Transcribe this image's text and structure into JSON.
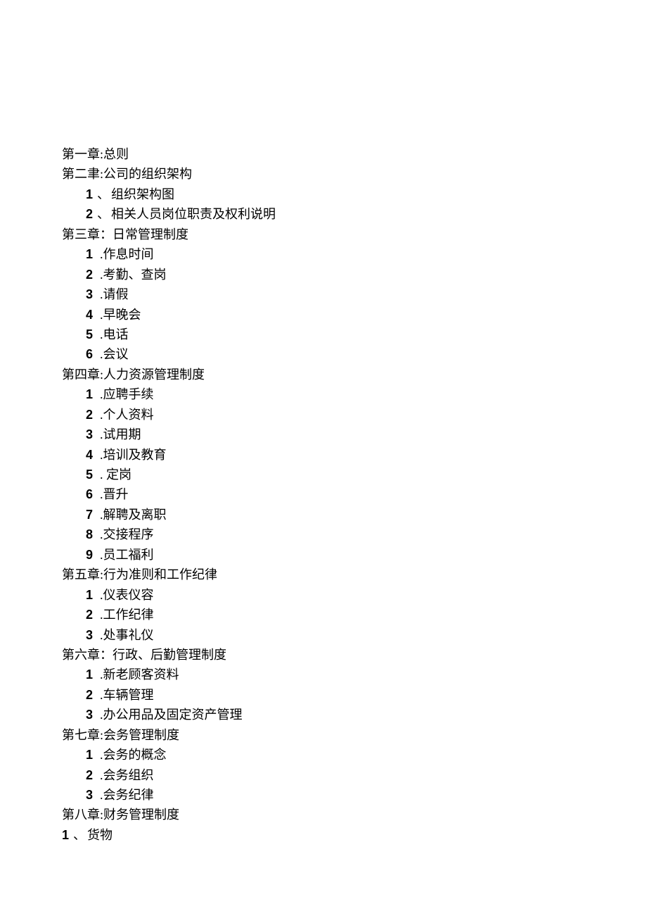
{
  "chapters": [
    {
      "title": "第一章:总则",
      "items": []
    },
    {
      "title": "第二聿:公司的组织架构",
      "items": [
        {
          "num": "1",
          "sep": "、",
          "text": "组织架构图"
        },
        {
          "num": "2",
          "sep": "、",
          "text": "相关人员岗位职责及权利说明"
        }
      ]
    },
    {
      "title": "第三章：日常管理制度",
      "items": [
        {
          "num": "1",
          "sep": ".",
          "text": "作息时间",
          "spaced": true
        },
        {
          "num": "2",
          "sep": ".",
          "text": "考勤、查岗",
          "spaced": true
        },
        {
          "num": "3",
          "sep": ".",
          "text": "请假",
          "spaced": true
        },
        {
          "num": "4",
          "sep": ".",
          "text": "早晚会",
          "spaced": true
        },
        {
          "num": "5",
          "sep": ".",
          "text": "电话",
          "spaced": true
        },
        {
          "num": "6",
          "sep": ".",
          "text": "会议",
          "spaced": true
        }
      ]
    },
    {
      "title": "第四章:人力资源管理制度",
      "items": [
        {
          "num": "1",
          "sep": ".",
          "text": "应聘手续",
          "spaced": true
        },
        {
          "num": "2",
          "sep": ".",
          "text": "个人资料",
          "spaced": true
        },
        {
          "num": "3",
          "sep": ".",
          "text": "试用期",
          "spaced": true
        },
        {
          "num": "4",
          "sep": ".",
          "text": "培训及教育",
          "spaced": true
        },
        {
          "num": "5",
          "sep": ".",
          "text": " 定岗",
          "spaced": true
        },
        {
          "num": "6",
          "sep": ".",
          "text": "晋升",
          "spaced": true
        },
        {
          "num": "7",
          "sep": ".",
          "text": "解聘及离职",
          "spaced": true
        },
        {
          "num": "8",
          "sep": ".",
          "text": "交接程序",
          "spaced": true
        },
        {
          "num": "9",
          "sep": ".",
          "text": "员工福利",
          "spaced": true
        }
      ]
    },
    {
      "title": "第五章:行为准则和工作纪律",
      "items": [
        {
          "num": "1",
          "sep": ".",
          "text": "仪表仪容",
          "spaced": true
        },
        {
          "num": "2",
          "sep": ".",
          "text": "工作纪律",
          "spaced": true
        },
        {
          "num": "3",
          "sep": ".",
          "text": "处事礼仪",
          "spaced": true
        }
      ]
    },
    {
      "title": "第六章：行政、后勤管理制度",
      "items": [
        {
          "num": "1",
          "sep": ".",
          "text": "新老顾客资料",
          "spaced": true
        },
        {
          "num": "2",
          "sep": ".",
          "text": "车辆管理",
          "spaced": true
        },
        {
          "num": "3",
          "sep": ".",
          "text": "办公用品及固定资产管理",
          "spaced": true
        }
      ]
    },
    {
      "title": "第七章:会务管理制度",
      "items": [
        {
          "num": "1",
          "sep": ".",
          "text": "会务的概念",
          "spaced": true
        },
        {
          "num": "2",
          "sep": ".",
          "text": "会务组织",
          "spaced": true
        },
        {
          "num": "3",
          "sep": ".",
          "text": "会务纪律",
          "spaced": true
        }
      ]
    },
    {
      "title": "第八章:财务管理制度",
      "items": [
        {
          "num": "1",
          "sep": "、",
          "text": "货物",
          "flush": true
        }
      ]
    }
  ]
}
